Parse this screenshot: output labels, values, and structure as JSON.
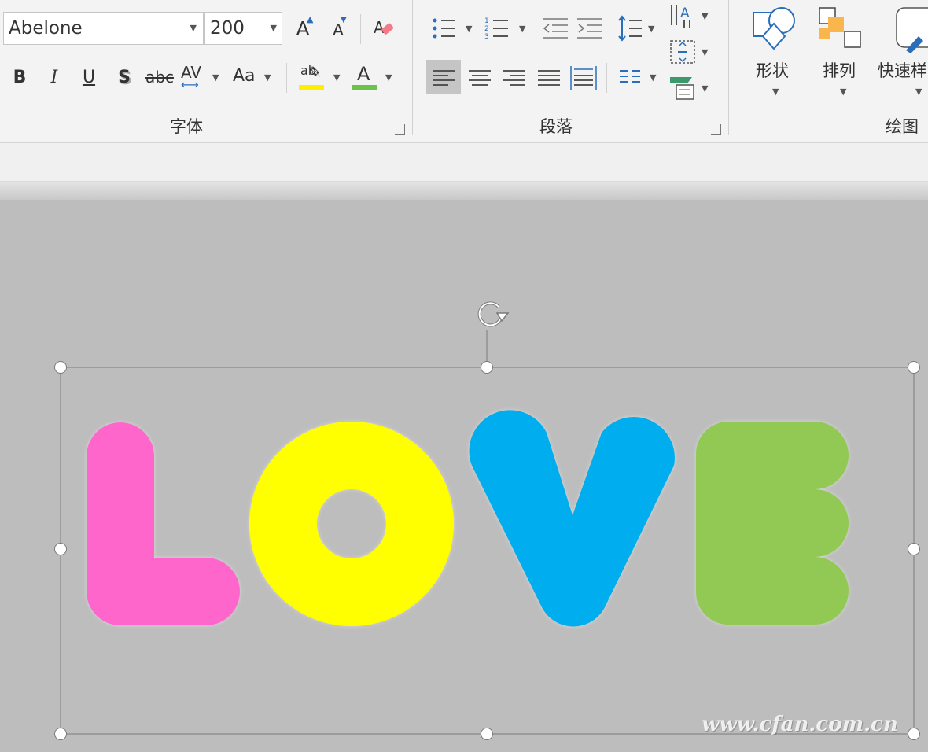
{
  "ribbon": {
    "font_group": {
      "label": "字体",
      "font_name": "Abelone",
      "font_size": "200",
      "bold": "B",
      "italic": "I",
      "underline": "U",
      "shadow": "S",
      "strikethrough": "abc",
      "spacing": "AV",
      "change_case": "Aa",
      "highlight": "ab",
      "font_color": "A",
      "grow": "A",
      "shrink": "A",
      "highlight_color": "#ffee00",
      "font_color_bar": "#6cc24a"
    },
    "paragraph_group": {
      "label": "段落"
    },
    "drawing_group": {
      "label": "绘图",
      "shapes_label": "形状",
      "arrange_label": "排列",
      "quick_styles_label": "快速样式"
    }
  },
  "canvas": {
    "text_letters": [
      {
        "char": "L",
        "color": "#ff66cc"
      },
      {
        "char": "O",
        "color": "#ffff00"
      },
      {
        "char": "V",
        "color": "#00aeef"
      },
      {
        "char": "E",
        "color": "#92c954"
      }
    ],
    "background": "#bebdbe"
  },
  "watermark": "www.cfan.com.cn"
}
